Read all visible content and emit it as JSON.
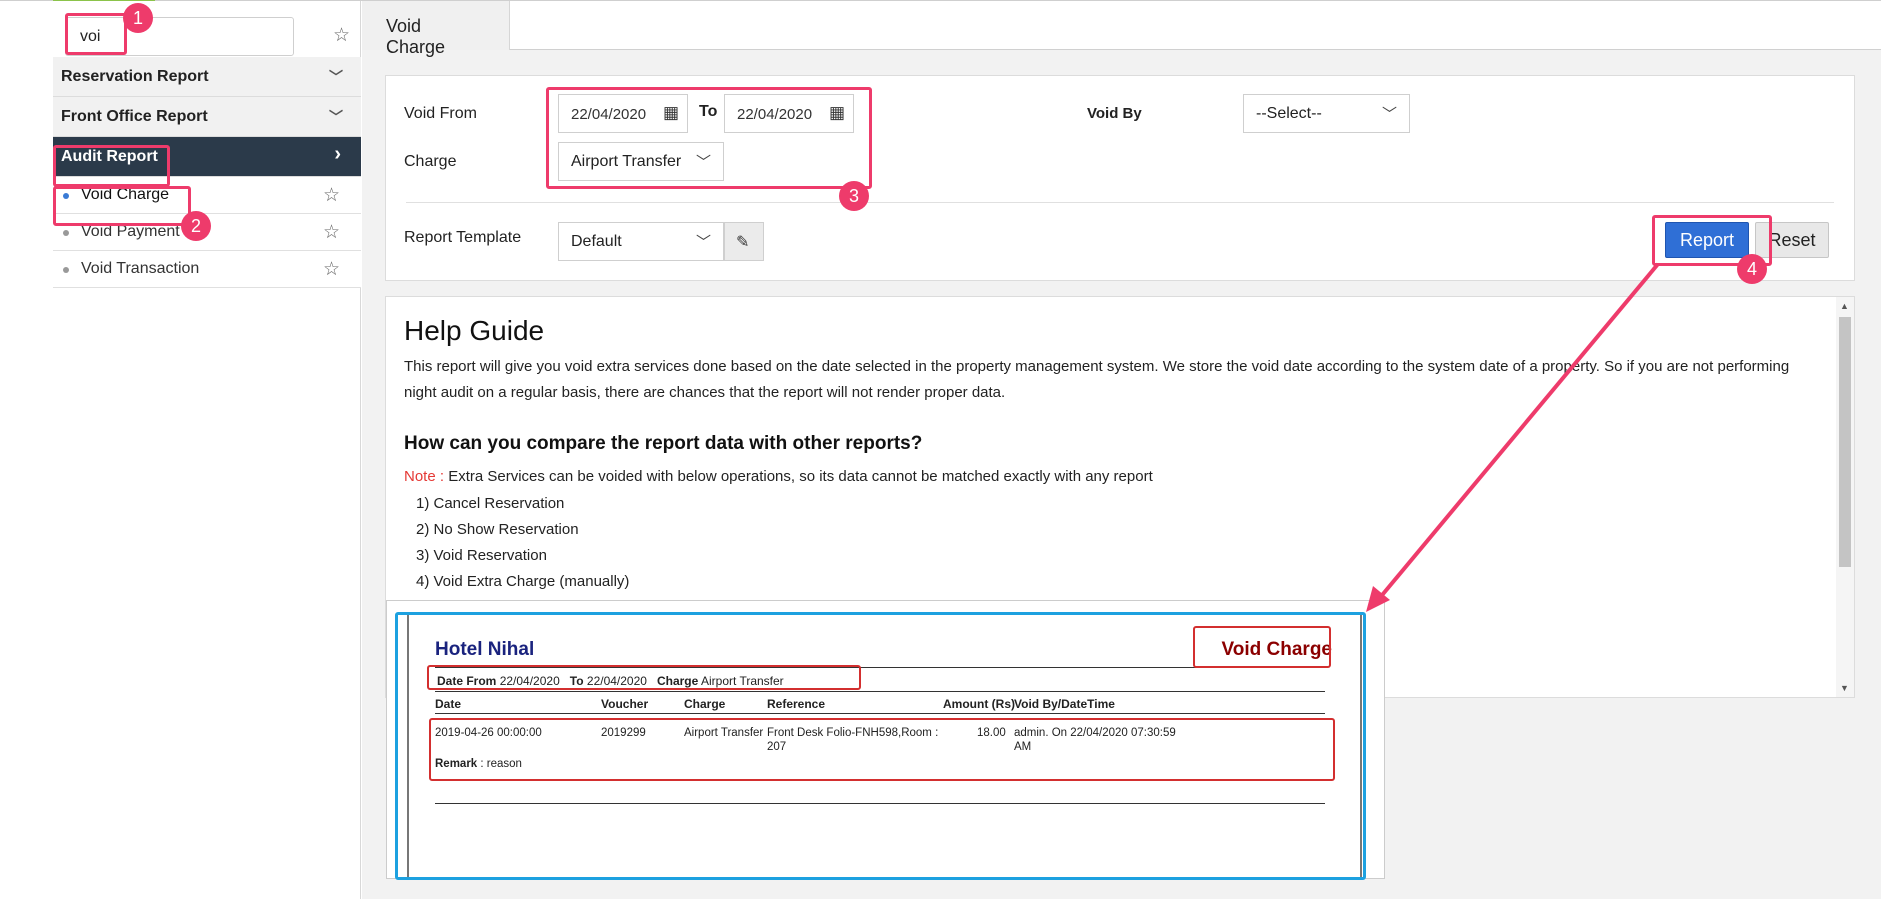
{
  "sidebar": {
    "search": {
      "value": "voi",
      "placeholder": ""
    },
    "menu": [
      {
        "label": "Reservation Report",
        "expanded": false
      },
      {
        "label": "Front Office Report",
        "expanded": false
      },
      {
        "label": "Audit Report",
        "expanded": true
      }
    ],
    "sub_items": [
      {
        "label": "Void Charge",
        "selected": true
      },
      {
        "label": "Void Payment",
        "selected": false
      },
      {
        "label": "Void Transaction",
        "selected": false
      }
    ]
  },
  "tabs": [
    {
      "label": "Void Charge",
      "active": true
    }
  ],
  "filters": {
    "void_from_label": "Void From",
    "from_date": "22/04/2020",
    "to_label": "To",
    "to_date": "22/04/2020",
    "void_by_label": "Void By",
    "void_by_value": "--Select--",
    "charge_label": "Charge",
    "charge_value": "Airport Transfer",
    "template_label": "Report Template",
    "template_value": "Default"
  },
  "buttons": {
    "report": "Report",
    "reset": "Reset"
  },
  "help": {
    "title": "Help Guide",
    "paragraph": "This report will give you void extra services done based on the date selected in the property management system. We store the void date according to the system date of a property. So if you are not performing night audit on a regular basis, there are chances that the report will not render proper data.",
    "subtitle": "How can you compare the report data with other reports?",
    "note_label": "Note :",
    "note_text": " Extra Services can be voided with below operations, so its data cannot be matched exactly with any report",
    "list": [
      "1) Cancel Reservation",
      "2) No Show Reservation",
      "3) Void Reservation",
      "4) Void Extra Charge (manually)"
    ]
  },
  "preview": {
    "hotel": "Hotel Nihal",
    "title": "Void Charge",
    "meta": {
      "date_from_label": "Date From",
      "date_from": "22/04/2020",
      "to_label": "To",
      "to": "22/04/2020",
      "charge_label": "Charge",
      "charge": "Airport Transfer"
    },
    "columns": [
      "Date",
      "Voucher",
      "Charge",
      "Reference",
      "Amount (Rs)",
      "Void By/DateTime"
    ],
    "row": {
      "date": "2019-04-26 00:00:00",
      "voucher": "2019299",
      "charge": "Airport Transfer",
      "reference_line1": "Front Desk Folio-FNH598,Room :",
      "reference_line2": "207",
      "amount": "18.00",
      "void_by_line1": "admin. On 22/04/2020 07:30:59",
      "void_by_line2": "AM",
      "remark_label": "Remark",
      "remark": " : reason"
    }
  },
  "annotations": [
    "1",
    "2",
    "3",
    "4"
  ],
  "colors": {
    "accent_pink": "#ee3b6b",
    "accent_blue": "#1da1e0",
    "report_button": "#2f6fd6",
    "sidebar_active": "#2b3a4a",
    "note_red": "#e53935"
  }
}
